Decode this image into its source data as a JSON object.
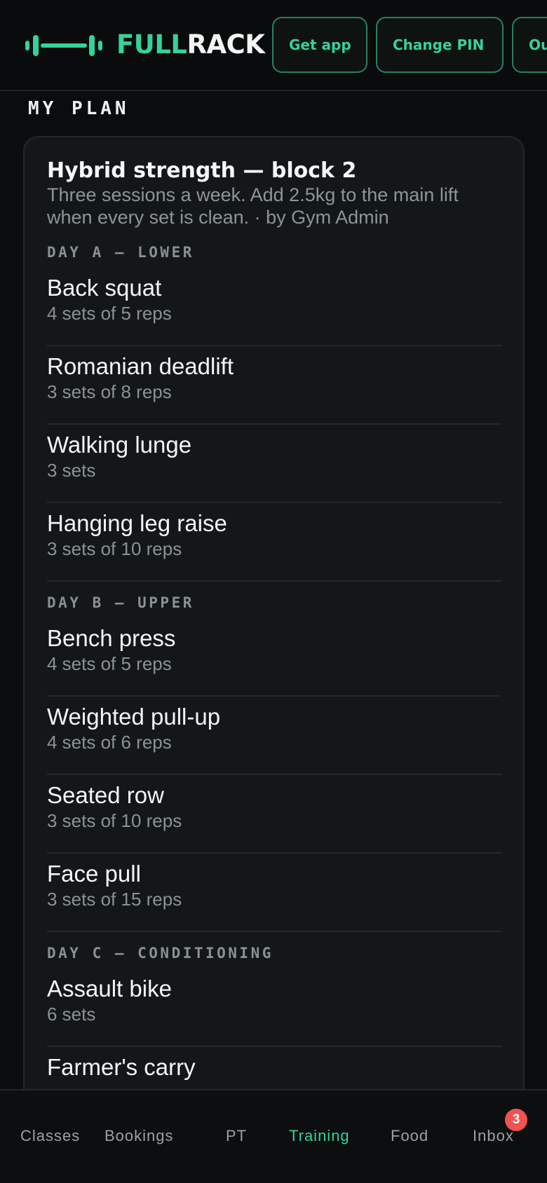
{
  "header": {
    "brand_part1": "FULL",
    "brand_part2": "RACK",
    "get_app": "Get app",
    "change_pin": "Change PIN",
    "out_truncated": "Ou"
  },
  "section_title": "MY PLAN",
  "plan": {
    "title": "Hybrid strength — block 2",
    "description": "Three sessions a week. Add 2.5kg to the main lift when every set is clean. · by Gym Admin",
    "days": [
      {
        "label": "DAY A — LOWER",
        "exercises": [
          {
            "name": "Back squat",
            "detail": "4 sets of 5 reps"
          },
          {
            "name": "Romanian deadlift",
            "detail": "3 sets of 8 reps"
          },
          {
            "name": "Walking lunge",
            "detail": "3 sets"
          },
          {
            "name": "Hanging leg raise",
            "detail": "3 sets of 10 reps"
          }
        ]
      },
      {
        "label": "DAY B — UPPER",
        "exercises": [
          {
            "name": "Bench press",
            "detail": "4 sets of 5 reps"
          },
          {
            "name": "Weighted pull-up",
            "detail": "4 sets of 6 reps"
          },
          {
            "name": "Seated row",
            "detail": "3 sets of 10 reps"
          },
          {
            "name": "Face pull",
            "detail": "3 sets of 15 reps"
          }
        ]
      },
      {
        "label": "DAY C — CONDITIONING",
        "exercises": [
          {
            "name": "Assault bike",
            "detail": "6 sets"
          },
          {
            "name": "Farmer's carry",
            "detail": ""
          }
        ]
      }
    ]
  },
  "nav": {
    "items": [
      "Classes",
      "Bookings",
      "PT",
      "Training",
      "Food",
      "Inbox"
    ],
    "active": "Training",
    "inbox_badge": "3"
  },
  "colors": {
    "accent": "#34d399",
    "background": "#0b0c0d",
    "card": "#141719",
    "badge": "#f05252"
  },
  "icons": {
    "logo": "barbell-icon"
  }
}
